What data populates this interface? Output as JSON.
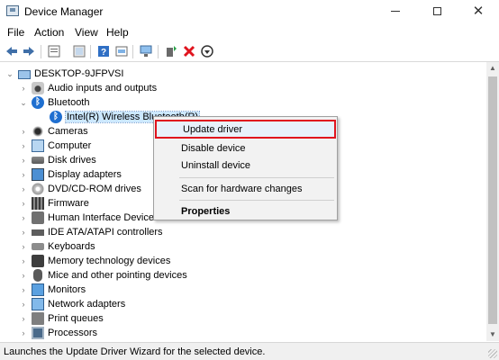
{
  "window": {
    "title": "Device Manager"
  },
  "menu": [
    "File",
    "Action",
    "View",
    "Help"
  ],
  "toolbar": [
    "back-icon",
    "forward-icon",
    "properties-icon",
    "show-hidden-icon",
    "help-icon",
    "update-driver-icon",
    "scan-hardware-icon",
    "add-driver-icon",
    "uninstall-icon",
    "disable-icon"
  ],
  "tree": {
    "root": "DESKTOP-9JFPVSI",
    "categories": [
      {
        "label": "Audio inputs and outputs",
        "icon": "speaker-icon",
        "expanded": false
      },
      {
        "label": "Bluetooth",
        "icon": "bluetooth-icon",
        "expanded": true,
        "children": [
          "Intel(R) Wireless Bluetooth(R)"
        ]
      },
      {
        "label": "Cameras",
        "icon": "camera-icon",
        "expanded": false
      },
      {
        "label": "Computer",
        "icon": "computer-icon",
        "expanded": false
      },
      {
        "label": "Disk drives",
        "icon": "disk-icon",
        "expanded": false
      },
      {
        "label": "Display adapters",
        "icon": "display-icon",
        "expanded": false
      },
      {
        "label": "DVD/CD-ROM drives",
        "icon": "dvd-icon",
        "expanded": false
      },
      {
        "label": "Firmware",
        "icon": "firmware-icon",
        "expanded": false
      },
      {
        "label": "Human Interface Devices",
        "icon": "hid-icon",
        "expanded": false
      },
      {
        "label": "IDE ATA/ATAPI controllers",
        "icon": "ide-icon",
        "expanded": false
      },
      {
        "label": "Keyboards",
        "icon": "keyboard-icon",
        "expanded": false
      },
      {
        "label": "Memory technology devices",
        "icon": "memory-icon",
        "expanded": false
      },
      {
        "label": "Mice and other pointing devices",
        "icon": "mouse-icon",
        "expanded": false
      },
      {
        "label": "Monitors",
        "icon": "monitor-icon",
        "expanded": false
      },
      {
        "label": "Network adapters",
        "icon": "network-icon",
        "expanded": false
      },
      {
        "label": "Print queues",
        "icon": "printer-icon",
        "expanded": false
      },
      {
        "label": "Processors",
        "icon": "processor-icon",
        "expanded": false
      }
    ]
  },
  "context_menu": {
    "items": [
      "Update driver",
      "Disable device",
      "Uninstall device",
      "Scan for hardware changes",
      "Properties"
    ],
    "highlighted": "Update driver",
    "highlight_color": "#e0141e"
  },
  "status": "Launches the Update Driver Wizard for the selected device."
}
